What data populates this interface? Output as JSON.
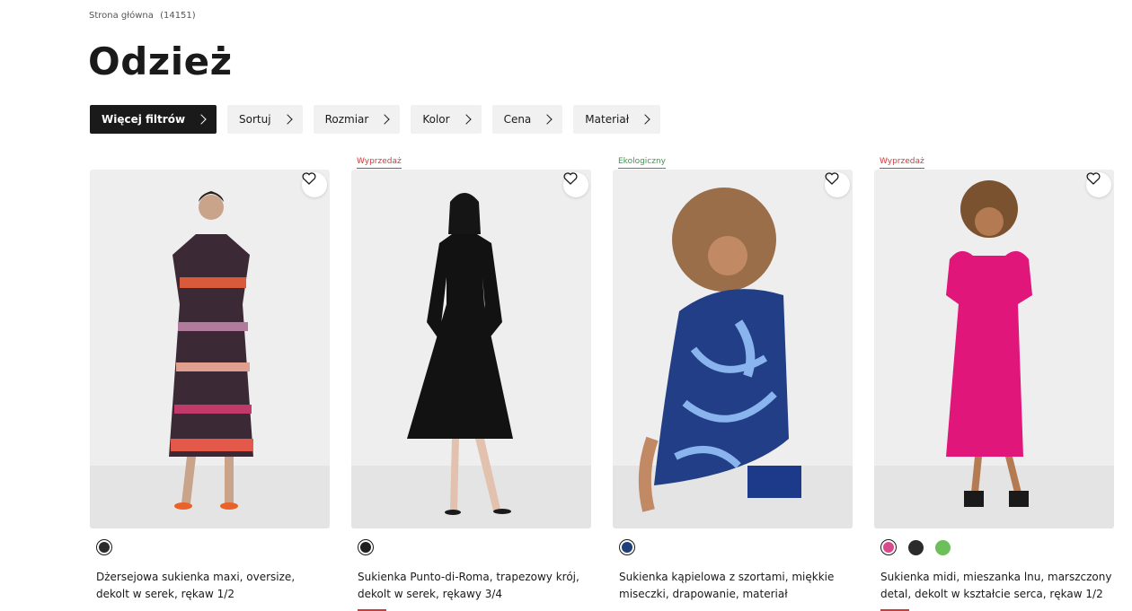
{
  "breadcrumb": {
    "home": "Strona główna",
    "count": "(14151)"
  },
  "title": "Odzież",
  "filters": [
    {
      "label": "Więcej filtrów"
    },
    {
      "label": "Sortuj"
    },
    {
      "label": "Rozmiar"
    },
    {
      "label": "Kolor"
    },
    {
      "label": "Cena"
    },
    {
      "label": "Materiał"
    }
  ],
  "products": [
    {
      "badge": "",
      "name": "Dżersejowa sukienka maxi, oversize, dekolt w serek, rękaw 1/2",
      "colors": [
        "#2b2b2b"
      ]
    },
    {
      "badge": "Wyprzedaż",
      "name": "Sukienka Punto-di-Roma, trapezowy krój, dekolt w serek, rękawy 3/4",
      "colors": [
        "#1f1f1f"
      ]
    },
    {
      "badge": "Ekologiczny",
      "name": "Sukienka kąpielowa z szortami, miękkie miseczki, drapowanie, materiał pochodzący z recyklingu",
      "colors": [
        "#1f3f7a"
      ]
    },
    {
      "badge": "Wyprzedaż",
      "name": "Sukienka midi, mieszanka lnu, marszczony detal, dekolt w kształcie serca, rękaw 1/2",
      "colors": [
        "#d94a8c",
        "#2b2b2b",
        "#6cbf5a"
      ]
    }
  ],
  "icons": {
    "wishlist": "heart-icon",
    "filter_arrow": "chevron-right-icon"
  },
  "accent": {
    "sale": "#d23a3a",
    "eco": "#3c9a4a"
  }
}
